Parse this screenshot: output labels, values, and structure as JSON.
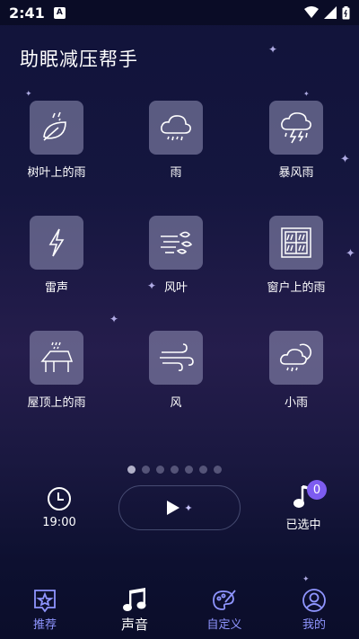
{
  "status_bar": {
    "time": "2:41",
    "notification_letter": "A"
  },
  "app": {
    "title": "助眠减压帮手"
  },
  "sounds": [
    {
      "label": "树叶上的雨",
      "icon": "leaf-rain-icon"
    },
    {
      "label": "雨",
      "icon": "rain-cloud-icon"
    },
    {
      "label": "暴风雨",
      "icon": "storm-icon"
    },
    {
      "label": "雷声",
      "icon": "lightning-icon"
    },
    {
      "label": "风叶",
      "icon": "wind-leaves-icon"
    },
    {
      "label": "窗户上的雨",
      "icon": "window-rain-icon"
    },
    {
      "label": "屋顶上的雨",
      "icon": "roof-rain-icon"
    },
    {
      "label": "风",
      "icon": "wind-icon"
    },
    {
      "label": "小雨",
      "icon": "light-rain-icon"
    }
  ],
  "pager": {
    "pages": 7,
    "active": 0
  },
  "controls": {
    "timer_label": "19:00",
    "selected_label": "已选中",
    "selected_count": "0"
  },
  "nav": [
    {
      "label": "推荐",
      "icon": "star-frame-icon"
    },
    {
      "label": "声音",
      "icon": "music-note-icon"
    },
    {
      "label": "自定义",
      "icon": "palette-icon"
    },
    {
      "label": "我的",
      "icon": "user-icon"
    }
  ],
  "colors": {
    "accent": "#8f95ff",
    "badge": "#7d5cf0",
    "tile": "#9696b9"
  }
}
